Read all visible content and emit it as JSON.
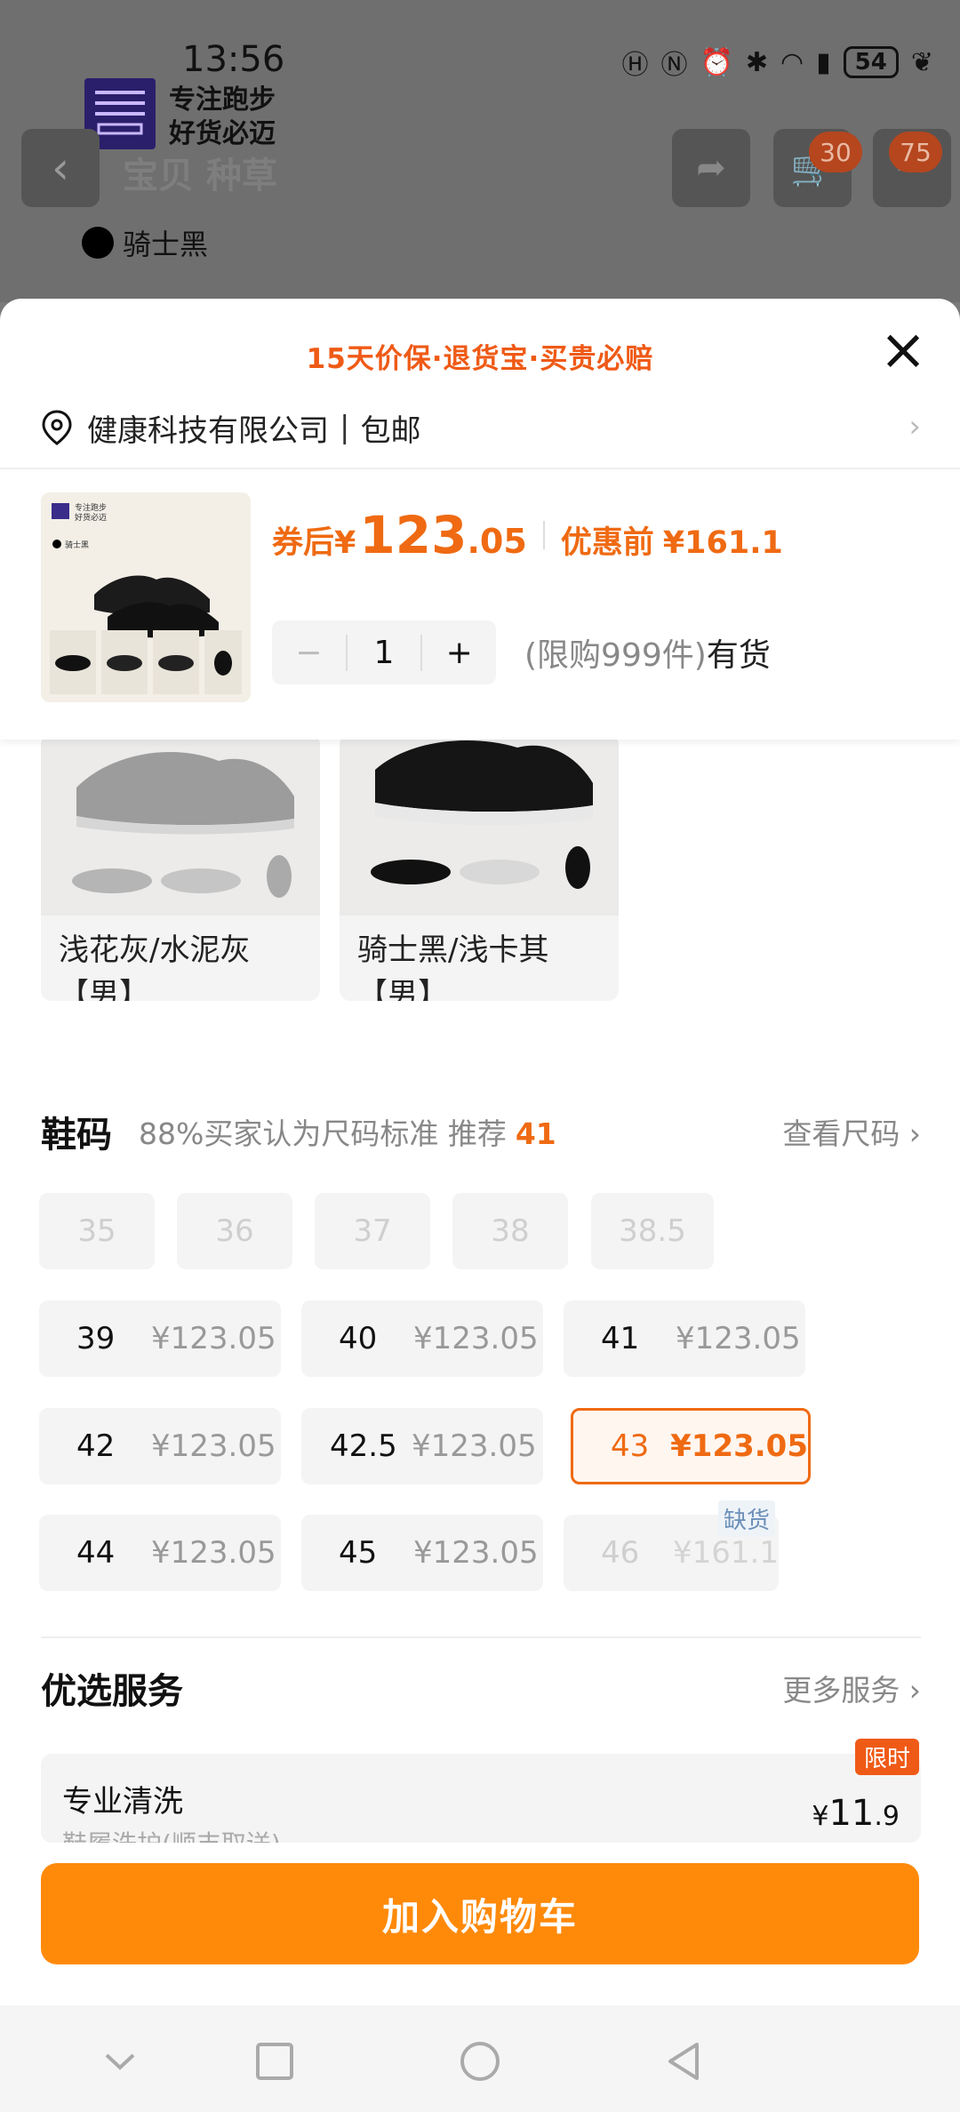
{
  "status": {
    "time": "13:56",
    "battery": "54",
    "icons": [
      "hd-icon",
      "nfc-icon",
      "alarm-icon",
      "bluetooth-icon",
      "wifi-icon",
      "4g-signal-icon",
      "battery-icon",
      "leaf-icon"
    ]
  },
  "background": {
    "logo_line1": "专注跑步",
    "logo_line2": "好货必迈",
    "tabs": "宝贝  种草",
    "cart_badge": "30",
    "more_badge": "75",
    "color_name": "骑士黑"
  },
  "sheet": {
    "promo": "15天价保·退货宝·买贵必赔",
    "address": "健康科技有限公司",
    "shipping": "包邮",
    "price_label": "券后",
    "price_currency": "¥",
    "price_int": "123",
    "price_dec": ".05",
    "orig_label": "优惠前",
    "orig_price": "¥161.1",
    "qty_minus": "−",
    "qty_value": "1",
    "qty_plus": "+",
    "stock_limit": "(限购999件)",
    "stock_status": "有货",
    "thumb_line1": "专注跑步",
    "thumb_line2": "好货必迈",
    "thumb_color": "骑士黑"
  },
  "colors": [
    {
      "label": "浅花灰/水泥灰【男】"
    },
    {
      "label": "骑士黑/浅卡其【男】"
    }
  ],
  "size_section": {
    "title": "鞋码",
    "tip": "88%买家认为尺码标准 推荐",
    "recommend": "41",
    "chart_link": "查看尺码 ›"
  },
  "sizes_disabled": [
    "35",
    "36",
    "37",
    "38",
    "38.5"
  ],
  "sizes": [
    {
      "size": "39",
      "price": "¥123.05"
    },
    {
      "size": "40",
      "price": "¥123.05"
    },
    {
      "size": "41",
      "price": "¥123.05"
    },
    {
      "size": "42",
      "price": "¥123.05"
    },
    {
      "size": "42.5",
      "price": "¥123.05"
    },
    {
      "size": "43",
      "price": "¥123.05"
    },
    {
      "size": "44",
      "price": "¥123.05"
    },
    {
      "size": "45",
      "price": "¥123.05"
    },
    {
      "size": "46",
      "price": "¥161.1"
    }
  ],
  "selected_size": "43",
  "oos_tag": "缺货",
  "services": {
    "title": "优选服务",
    "more": "更多服务 ›",
    "item_name": "专业清洗",
    "item_sub": "鞋履洗护(顺丰取送)",
    "item_badge": "限时",
    "item_price_cur": "¥",
    "item_price_int": "11",
    "item_price_dec": ".9"
  },
  "cart_button": "加入购物车",
  "colors_theme": {
    "accent": "#ef6a12",
    "button": "#ff8a0a"
  }
}
